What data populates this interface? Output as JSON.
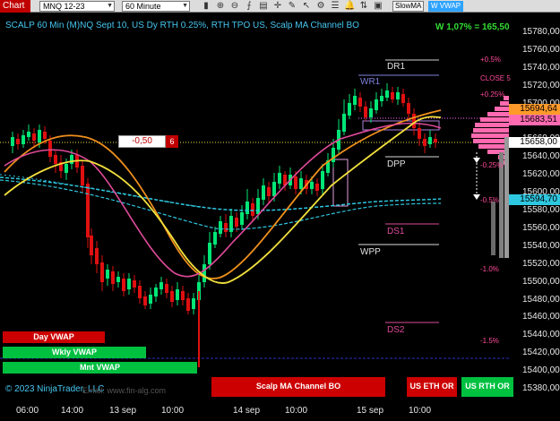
{
  "toolbar": {
    "chart_label": "Chart",
    "instrument": "MNQ 12-23",
    "timeframe": "60 Minute",
    "slow_ma": "SlowMA",
    "w_vwap": "W VWAP"
  },
  "chart": {
    "title": "SCALP 60 Min (M)NQ Sept 10, US Dy RTH 0.25%, RTH TPO US, Scalp MA Channel BO",
    "weekly_perc": "W 1,07% = 165,50",
    "offset_value": "-0,50",
    "offset_count": "6",
    "copyright": "© 2023 NinjaTrader, LLC",
    "footer_url": "Email: www.fin-alg.com",
    "levels": {
      "dr1": "DR1",
      "wr1": "WR1",
      "dpp": "DPP",
      "ds1": "DS1",
      "wpp": "WPP",
      "ds2": "DS2"
    },
    "percent_labels": {
      "p05": "+0.5%",
      "close": "CLOSE 5",
      "p025": "+0.25%",
      "m025": "-0.25%",
      "m05": "-0.5%",
      "m1": "-1.0%",
      "m15": "-1.5%"
    },
    "price_tags": {
      "tag1": "15694,64",
      "tag2": "15683,51",
      "tag3": "15658,00",
      "tag4": "15594,70"
    },
    "y_axis": [
      "15780,00",
      "15760,00",
      "15740,00",
      "15720,00",
      "15700,00",
      "15680,00",
      "15660,00",
      "15640,00",
      "15620,00",
      "15600,00",
      "15580,00",
      "15560,00",
      "15540,00",
      "15520,00",
      "15500,00",
      "15480,00",
      "15460,00",
      "15440,00",
      "15420,00",
      "15400,00",
      "15380,00"
    ],
    "x_axis": [
      "06:00",
      "14:00",
      "13 sep",
      "10:00",
      "14 sep",
      "10:00",
      "15 sep",
      "10:00"
    ],
    "left_bars": {
      "day_vwap": "Day VWAP",
      "wkly_vwap": "Wkly VWAP",
      "mnt_vwap": "Mnt VWAP"
    },
    "bottom_buttons": {
      "scalp": "Scalp MA Channel BO",
      "eth": "US ETH OR",
      "rth": "US RTH OR"
    }
  },
  "colors": {
    "bull": "#00e676",
    "bear": "#e01010",
    "orange_ma": "#f0901c",
    "yellow_ma": "#f2e03c",
    "pink_ma": "#e04a9a",
    "cyan_channel": "#2ec7e0",
    "title_cyan": "#46c7f0"
  }
}
